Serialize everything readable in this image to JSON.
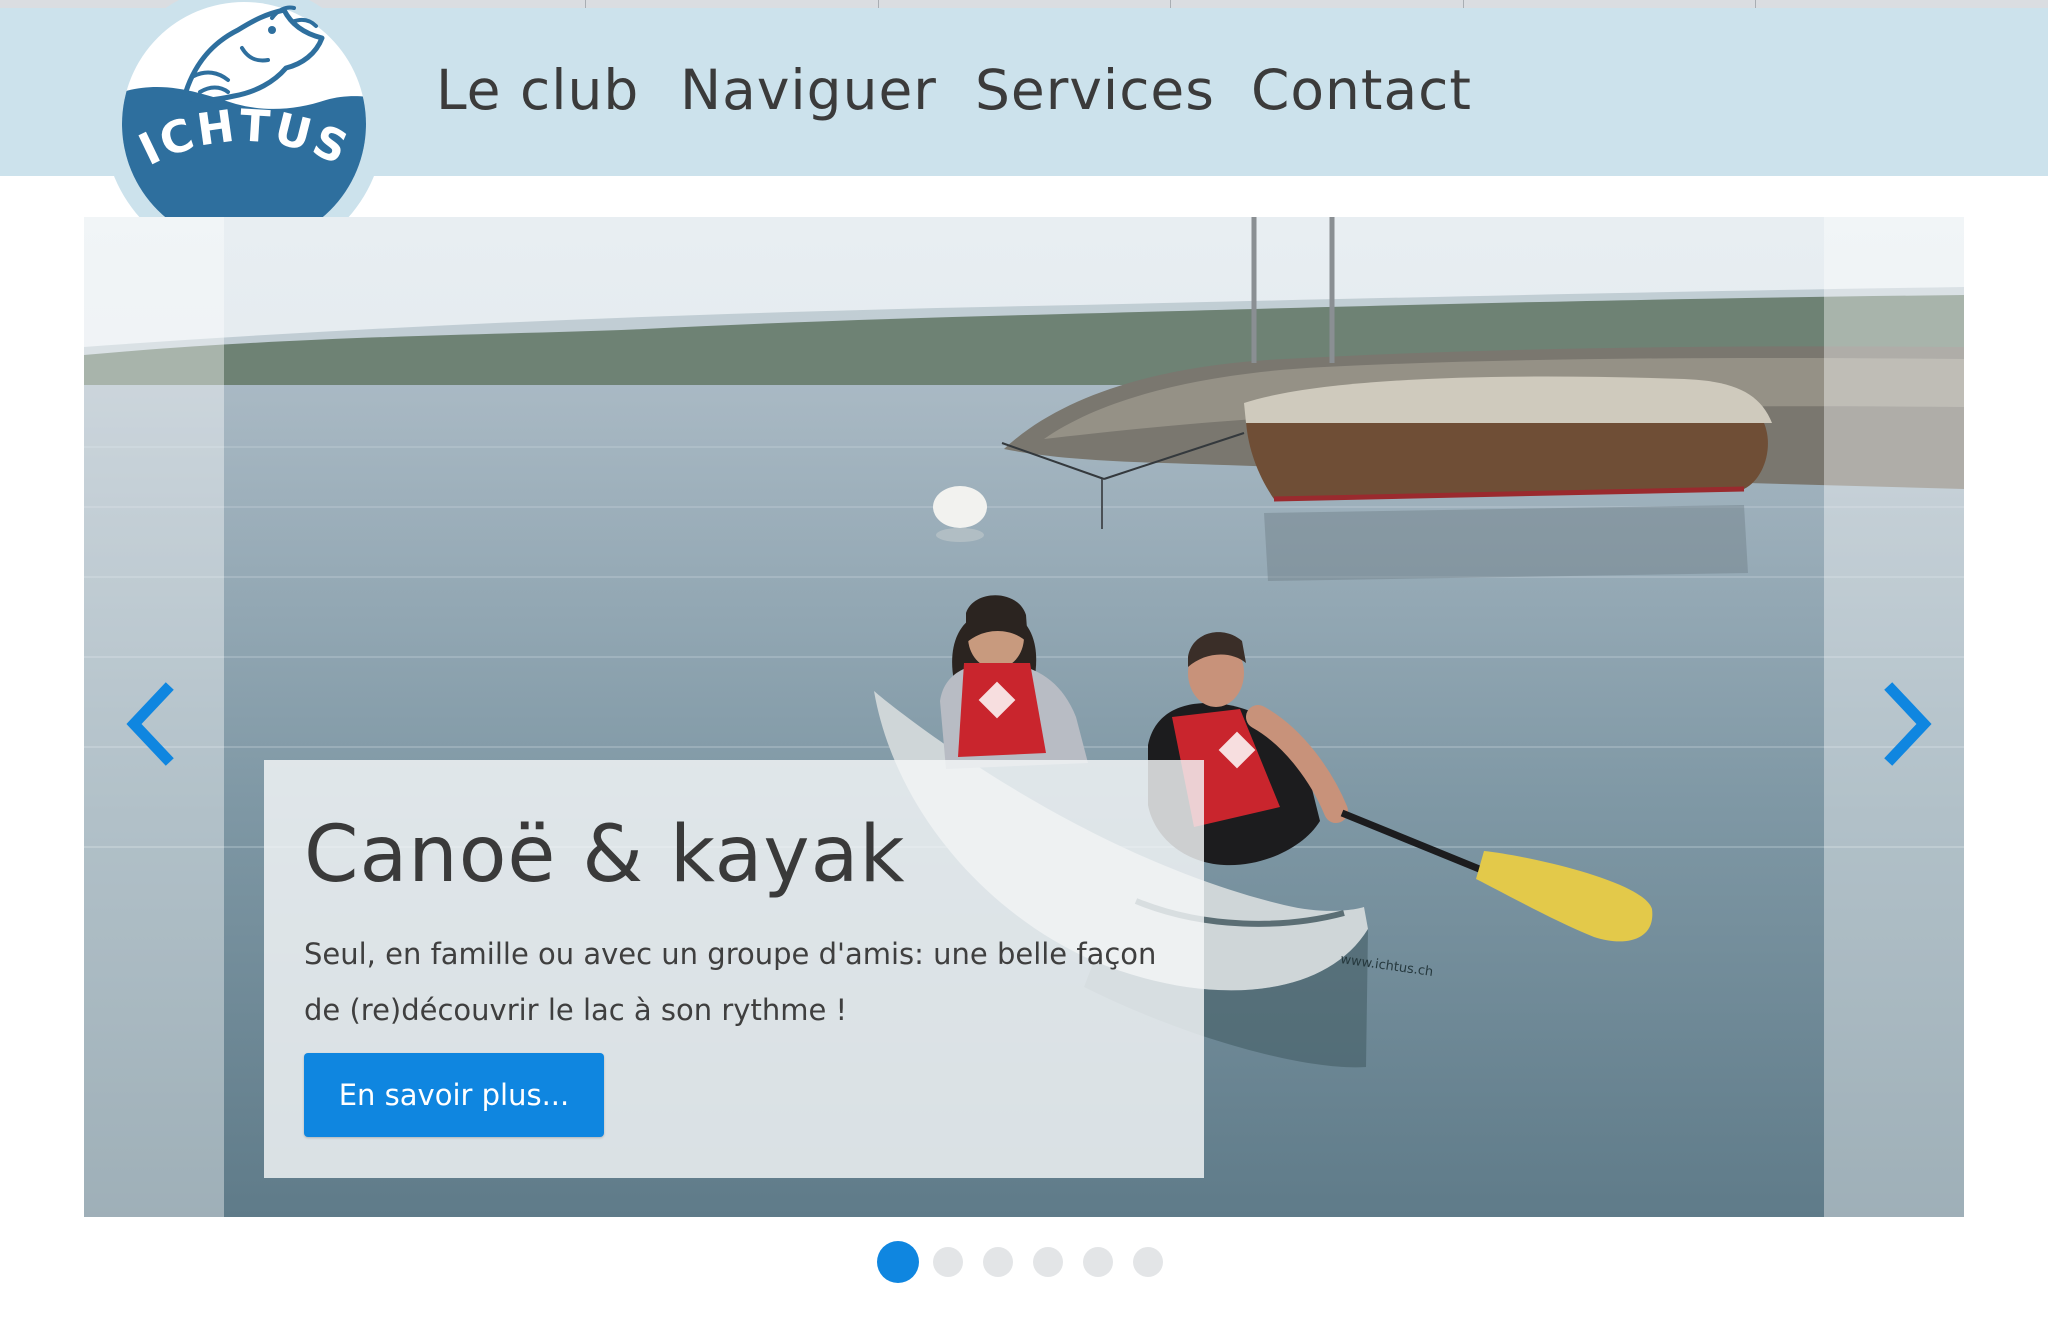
{
  "brand": {
    "name": "ICHTUS",
    "color": "#2e6f9e",
    "nav_bg": "#cce2ec"
  },
  "nav": {
    "items": [
      {
        "label": "Le club"
      },
      {
        "label": "Naviguer"
      },
      {
        "label": "Services"
      },
      {
        "label": "Contact"
      }
    ]
  },
  "slider": {
    "active_index": 0,
    "slide_count": 6,
    "prev_icon": "chevron-left-icon",
    "next_icon": "chevron-right-icon",
    "accent": "#0f86e0",
    "caption": {
      "title": "Canoë & kayak",
      "text": "Seul, en famille ou avec un groupe d'amis: une belle façon de (re)découvrir le lac à son rythme !",
      "button_label": "En savoir plus..."
    },
    "photo": {
      "canoe_print": "www.ichtus.ch"
    }
  }
}
